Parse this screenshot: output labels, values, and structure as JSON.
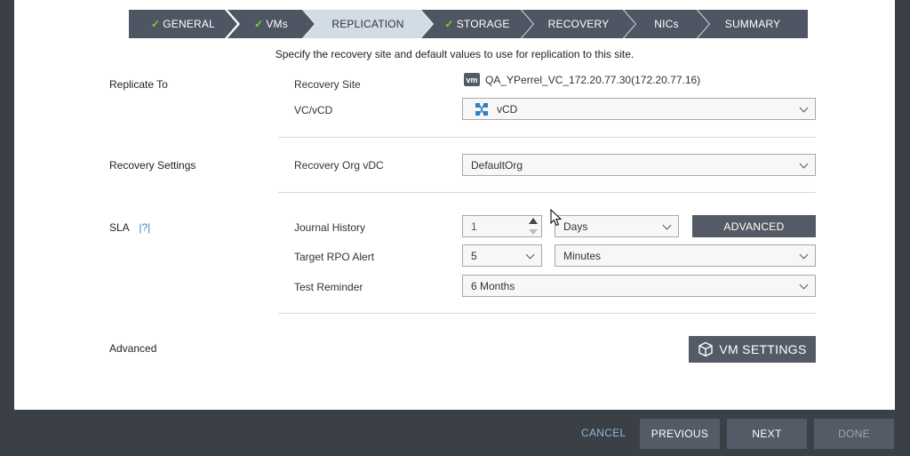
{
  "wizard": {
    "steps": [
      {
        "label": "GENERAL",
        "done": true
      },
      {
        "label": "VMs",
        "done": true
      },
      {
        "label": "REPLICATION",
        "done": false,
        "active": true
      },
      {
        "label": "STORAGE",
        "done": true
      },
      {
        "label": "RECOVERY",
        "done": false
      },
      {
        "label": "NICs",
        "done": false
      },
      {
        "label": "SUMMARY",
        "done": false
      }
    ],
    "check_glyph": "✓"
  },
  "intro": "Specify the recovery site and default values to use for replication to this site.",
  "replicate_to": {
    "section_label": "Replicate To",
    "recovery_site_label": "Recovery Site",
    "site_badge": "vm",
    "recovery_site_value": "QA_YPerrel_VC_172.20.77.30(172.20.77.16)",
    "vc_vcd_label": "VC/vCD",
    "vc_vcd_value": "vCD"
  },
  "recovery_settings": {
    "section_label": "Recovery Settings",
    "org_vdc_label": "Recovery Org vDC",
    "org_vdc_value": "DefaultOrg"
  },
  "sla": {
    "section_label": "SLA",
    "help_label": "|?|",
    "journal_history_label": "Journal History",
    "journal_history_value": "1",
    "journal_history_unit": "Days",
    "advanced_button": "ADVANCED",
    "target_rpo_label": "Target RPO Alert",
    "target_rpo_value": "5",
    "target_rpo_unit": "Minutes",
    "test_reminder_label": "Test Reminder",
    "test_reminder_value": "6 Months"
  },
  "advanced": {
    "section_label": "Advanced",
    "vm_settings_button": "VM SETTINGS"
  },
  "footer": {
    "cancel": "CANCEL",
    "previous": "PREVIOUS",
    "next": "NEXT",
    "done": "DONE"
  },
  "colors": {
    "step_bg": "#4f5663",
    "step_active_bg": "#d2dce6",
    "check": "#7ed321",
    "button_dark": "#545b66",
    "link": "#8fb7d9"
  }
}
